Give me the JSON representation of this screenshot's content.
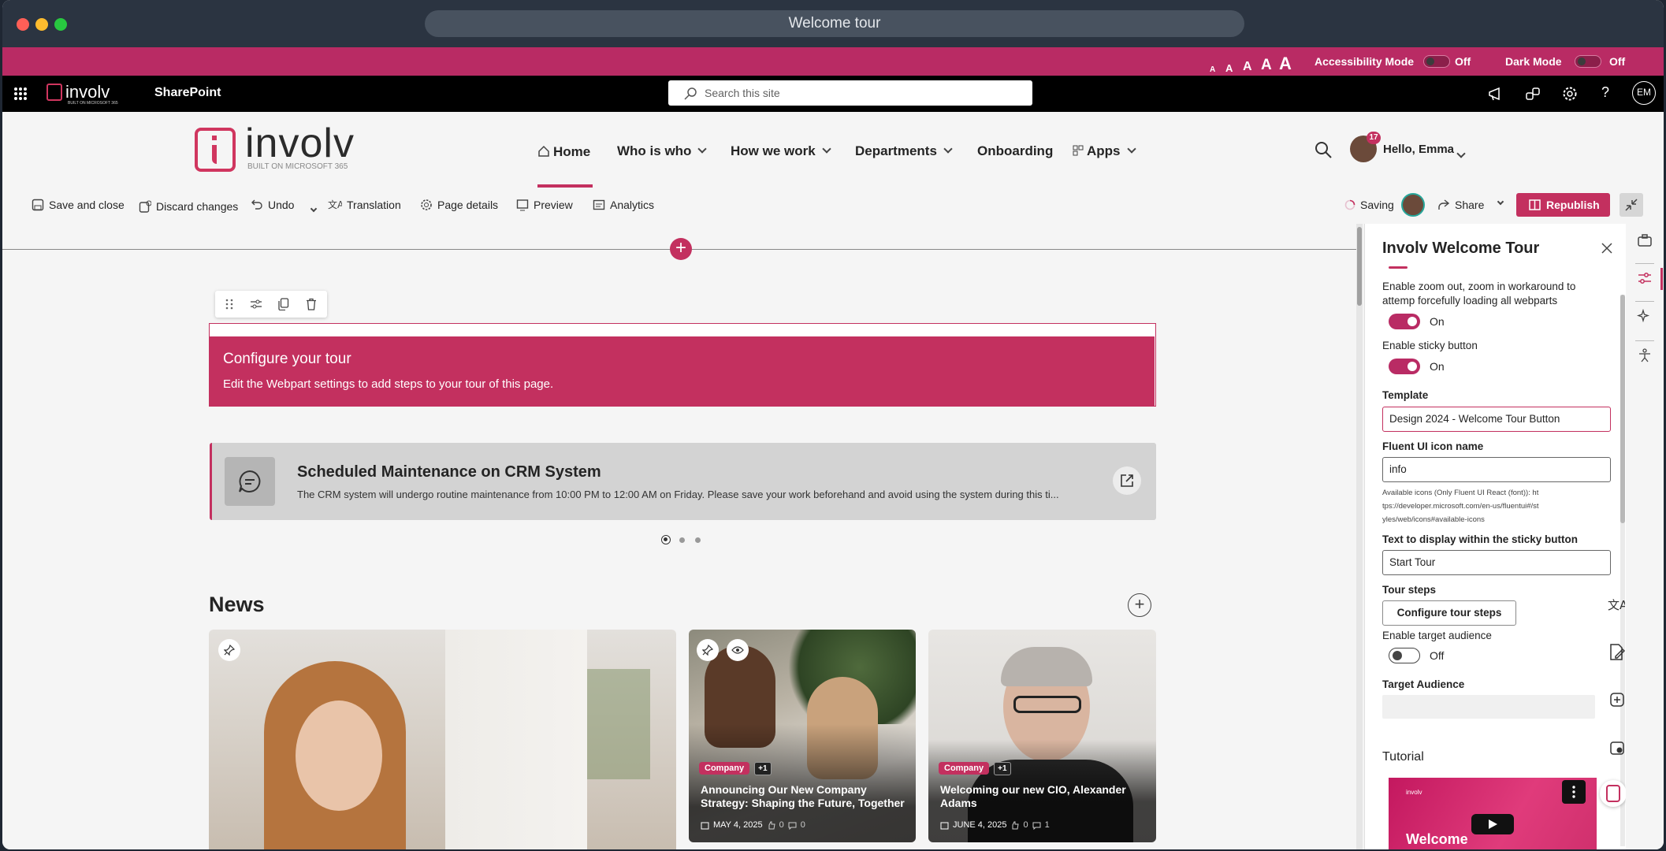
{
  "browser": {
    "tab_title": "Welcome tour"
  },
  "accessibility_bar": {
    "font_sizes": [
      "A",
      "A",
      "A",
      "A",
      "A"
    ],
    "accessibility_label": "Accessibility Mode",
    "accessibility_state": "Off",
    "dark_label": "Dark Mode",
    "dark_state": "Off"
  },
  "suite_bar": {
    "logo_text": "involv",
    "logo_sub": "BUILT ON MICROSOFT 365",
    "app_name": "SharePoint",
    "search_placeholder": "Search this site",
    "avatar_initials": "EM"
  },
  "hub": {
    "logo_text": "involv",
    "logo_sub": "BUILT ON MICROSOFT 365",
    "nav": [
      {
        "label": "Home"
      },
      {
        "label": "Who is who"
      },
      {
        "label": "How we work"
      },
      {
        "label": "Departments"
      },
      {
        "label": "Onboarding"
      },
      {
        "label": "Apps"
      }
    ],
    "notification_count": "17",
    "greeting": "Hello, Emma"
  },
  "command_bar": {
    "save_close": "Save and close",
    "discard": "Discard changes",
    "undo": "Undo",
    "translation": "Translation",
    "page_details": "Page details",
    "preview": "Preview",
    "analytics": "Analytics",
    "saving": "Saving",
    "share": "Share",
    "republish": "Republish"
  },
  "tour_banner": {
    "title": "Configure your tour",
    "subtitle": "Edit the Webpart settings to add steps to your tour of this page."
  },
  "alert": {
    "title": "Scheduled Maintenance on CRM System",
    "body": "The CRM system will undergo routine maintenance from 10:00 PM to 12:00 AM on Friday. Please save your work beforehand and avoid using the system during this ti..."
  },
  "news": {
    "heading": "News",
    "cards": [
      {
        "tag": "Company",
        "extra": "+1",
        "title": "Announcing Our New Company Strategy: Shaping the Future, Together",
        "date": "MAY 4, 2025",
        "likes": "0",
        "comments": "0"
      },
      {
        "tag": "Company",
        "extra": "+1",
        "title": "Welcoming our new CIO, Alexander Adams",
        "date": "JUNE 4, 2025",
        "likes": "0",
        "comments": "1"
      }
    ]
  },
  "panel": {
    "title": "Involv Welcome Tour",
    "zoom_label": "Enable zoom out, zoom in workaround to attemp forcefully loading all webparts",
    "zoom_state": "On",
    "sticky_label": "Enable sticky button",
    "sticky_state": "On",
    "template_label": "Template",
    "template_value": "Design 2024 - Welcome Tour Button",
    "icon_label": "Fluent UI icon name",
    "icon_value": "info",
    "icon_help": "Available icons (Only Fluent UI React (font)): https://developer.microsoft.com/en-us/fluentui#/styles/web/icons#available-icons",
    "text_label": "Text to display within the sticky button",
    "text_value": "Start Tour",
    "steps_label": "Tour steps",
    "steps_button": "Configure tour steps",
    "audience_toggle_label": "Enable target audience",
    "audience_toggle_state": "Off",
    "audience_label": "Target Audience",
    "tutorial_label": "Tutorial",
    "video_logo": "involv",
    "video_title": "Welcome"
  },
  "colors": {
    "accent": "#b92b64",
    "suite": "#000000",
    "titlebar": "#2b3441"
  }
}
